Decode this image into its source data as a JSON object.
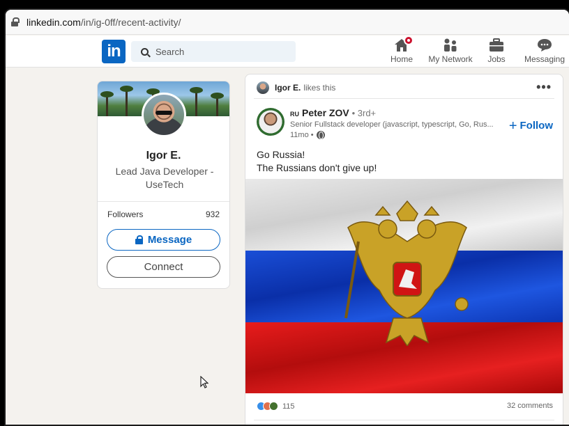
{
  "browser": {
    "url_host": "linkedin.com",
    "url_path": "/in/ig-0ff/recent-activity/"
  },
  "nav": {
    "logo": "in",
    "search_placeholder": "Search",
    "items": [
      {
        "label": "Home",
        "icon": "home-icon"
      },
      {
        "label": "My Network",
        "icon": "network-icon"
      },
      {
        "label": "Jobs",
        "icon": "briefcase-icon"
      },
      {
        "label": "Messaging",
        "icon": "messaging-icon"
      }
    ]
  },
  "profile": {
    "name": "Igor E.",
    "headline": "Lead Java Developer - UseTech",
    "followers_label": "Followers",
    "followers_count": "932",
    "message_label": "Message",
    "connect_label": "Connect"
  },
  "post": {
    "liker_name": "Igor E.",
    "liker_action": "likes this",
    "author_flag": "RU",
    "author_name": "Peter ZOV",
    "author_degree": "• 3rd+",
    "author_headline": "Senior Fullstack developer (javascript, typescript, Go, Rus...",
    "time": "11mo •",
    "follow_label": "Follow",
    "text_line1": "Go Russia!",
    "text_line2": "The Russians don't give up!",
    "reactions_count": "115",
    "comments": "32 comments"
  },
  "colors": {
    "brand": "#0a66c2",
    "notification": "#cb112d"
  }
}
